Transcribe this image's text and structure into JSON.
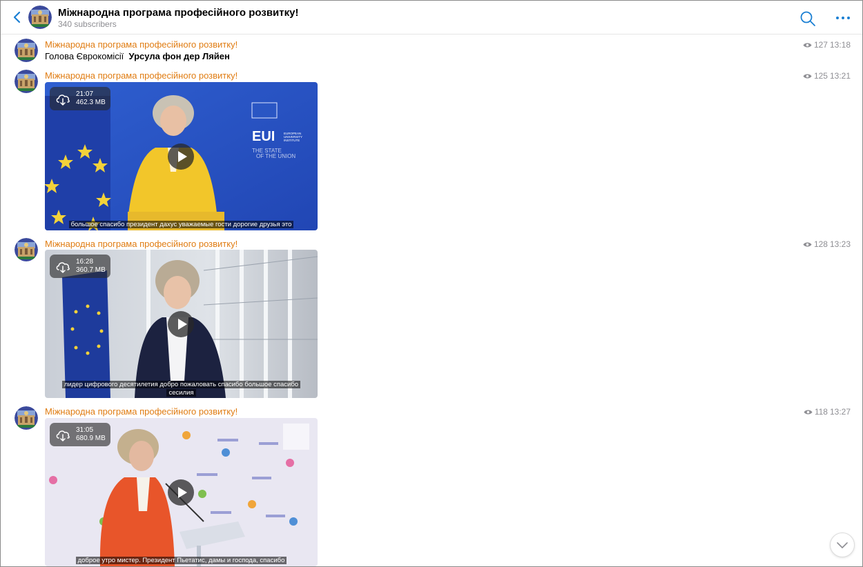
{
  "channel": {
    "title": "Міжнародна програма професійного розвитку!",
    "subtitle": "340 subscribers"
  },
  "messages": [
    {
      "sender": "Міжнародна програма професійного розвитку!",
      "views": "127",
      "time": "13:18",
      "text_prefix": "Голова Єврокомісії",
      "text_bold": "Урсула фон дер Ляйен"
    },
    {
      "sender": "Міжнародна програма професійного розвитку!",
      "views": "125",
      "time": "13:21",
      "video": {
        "duration": "21:07",
        "size": "462.3 MB",
        "caption_lines": [
          "большое спасибо президент дахус уважаемые гости дорогие друзья это"
        ],
        "scene_text": [
          "EUI",
          "EUROPEAN",
          "UNIVERSITY",
          "INSTITUTE",
          "THE STATE",
          "OF THE UNION"
        ]
      }
    },
    {
      "sender": "Міжнародна програма професійного розвитку!",
      "views": "128",
      "time": "13:23",
      "video": {
        "duration": "16:28",
        "size": "360.7 MB",
        "caption_lines": [
          "лидер цифрового десятилетия добро пожаловать спасибо большое спасибо",
          "сесилия"
        ]
      }
    },
    {
      "sender": "Міжнародна програма професійного розвитку!",
      "views": "118",
      "time": "13:27",
      "video": {
        "duration": "31:05",
        "size": "680.9 MB",
        "caption_lines": [
          "доброе утро мистер. Президент Пьетатис, дамы и господа, спасибо"
        ]
      }
    }
  ],
  "icons": {
    "back": "chevron-left-icon",
    "search": "search-icon",
    "more": "more-icon",
    "views": "eye-icon",
    "download": "cloud-download-icon",
    "play": "play-icon",
    "scroll": "chevron-down-icon"
  },
  "colors": {
    "accent": "#1a7fd3",
    "sender": "#e07c12",
    "meta": "#8e8e93"
  }
}
